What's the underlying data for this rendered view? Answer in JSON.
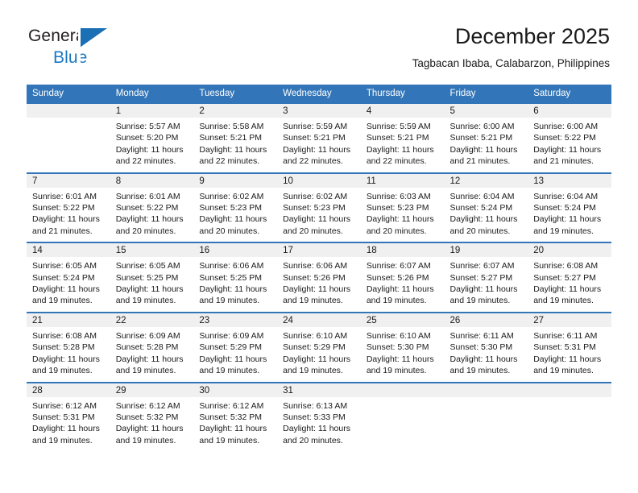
{
  "brand": {
    "line1": "General",
    "line2": "Blue",
    "accent_color": "#1b78c2",
    "triangle_color": "#1b6fb5"
  },
  "header": {
    "title": "December 2025",
    "subtitle": "Tagbacan Ibaba, Calabarzon, Philippines"
  },
  "calendar": {
    "header_bg": "#3275b8",
    "daynum_bg": "#f0f0f0",
    "weekdays": [
      "Sunday",
      "Monday",
      "Tuesday",
      "Wednesday",
      "Thursday",
      "Friday",
      "Saturday"
    ],
    "weeks": [
      [
        {
          "day": "",
          "lines": []
        },
        {
          "day": "1",
          "lines": [
            "Sunrise: 5:57 AM",
            "Sunset: 5:20 PM",
            "Daylight: 11 hours",
            "and 22 minutes."
          ]
        },
        {
          "day": "2",
          "lines": [
            "Sunrise: 5:58 AM",
            "Sunset: 5:21 PM",
            "Daylight: 11 hours",
            "and 22 minutes."
          ]
        },
        {
          "day": "3",
          "lines": [
            "Sunrise: 5:59 AM",
            "Sunset: 5:21 PM",
            "Daylight: 11 hours",
            "and 22 minutes."
          ]
        },
        {
          "day": "4",
          "lines": [
            "Sunrise: 5:59 AM",
            "Sunset: 5:21 PM",
            "Daylight: 11 hours",
            "and 22 minutes."
          ]
        },
        {
          "day": "5",
          "lines": [
            "Sunrise: 6:00 AM",
            "Sunset: 5:21 PM",
            "Daylight: 11 hours",
            "and 21 minutes."
          ]
        },
        {
          "day": "6",
          "lines": [
            "Sunrise: 6:00 AM",
            "Sunset: 5:22 PM",
            "Daylight: 11 hours",
            "and 21 minutes."
          ]
        }
      ],
      [
        {
          "day": "7",
          "lines": [
            "Sunrise: 6:01 AM",
            "Sunset: 5:22 PM",
            "Daylight: 11 hours",
            "and 21 minutes."
          ]
        },
        {
          "day": "8",
          "lines": [
            "Sunrise: 6:01 AM",
            "Sunset: 5:22 PM",
            "Daylight: 11 hours",
            "and 20 minutes."
          ]
        },
        {
          "day": "9",
          "lines": [
            "Sunrise: 6:02 AM",
            "Sunset: 5:23 PM",
            "Daylight: 11 hours",
            "and 20 minutes."
          ]
        },
        {
          "day": "10",
          "lines": [
            "Sunrise: 6:02 AM",
            "Sunset: 5:23 PM",
            "Daylight: 11 hours",
            "and 20 minutes."
          ]
        },
        {
          "day": "11",
          "lines": [
            "Sunrise: 6:03 AM",
            "Sunset: 5:23 PM",
            "Daylight: 11 hours",
            "and 20 minutes."
          ]
        },
        {
          "day": "12",
          "lines": [
            "Sunrise: 6:04 AM",
            "Sunset: 5:24 PM",
            "Daylight: 11 hours",
            "and 20 minutes."
          ]
        },
        {
          "day": "13",
          "lines": [
            "Sunrise: 6:04 AM",
            "Sunset: 5:24 PM",
            "Daylight: 11 hours",
            "and 19 minutes."
          ]
        }
      ],
      [
        {
          "day": "14",
          "lines": [
            "Sunrise: 6:05 AM",
            "Sunset: 5:24 PM",
            "Daylight: 11 hours",
            "and 19 minutes."
          ]
        },
        {
          "day": "15",
          "lines": [
            "Sunrise: 6:05 AM",
            "Sunset: 5:25 PM",
            "Daylight: 11 hours",
            "and 19 minutes."
          ]
        },
        {
          "day": "16",
          "lines": [
            "Sunrise: 6:06 AM",
            "Sunset: 5:25 PM",
            "Daylight: 11 hours",
            "and 19 minutes."
          ]
        },
        {
          "day": "17",
          "lines": [
            "Sunrise: 6:06 AM",
            "Sunset: 5:26 PM",
            "Daylight: 11 hours",
            "and 19 minutes."
          ]
        },
        {
          "day": "18",
          "lines": [
            "Sunrise: 6:07 AM",
            "Sunset: 5:26 PM",
            "Daylight: 11 hours",
            "and 19 minutes."
          ]
        },
        {
          "day": "19",
          "lines": [
            "Sunrise: 6:07 AM",
            "Sunset: 5:27 PM",
            "Daylight: 11 hours",
            "and 19 minutes."
          ]
        },
        {
          "day": "20",
          "lines": [
            "Sunrise: 6:08 AM",
            "Sunset: 5:27 PM",
            "Daylight: 11 hours",
            "and 19 minutes."
          ]
        }
      ],
      [
        {
          "day": "21",
          "lines": [
            "Sunrise: 6:08 AM",
            "Sunset: 5:28 PM",
            "Daylight: 11 hours",
            "and 19 minutes."
          ]
        },
        {
          "day": "22",
          "lines": [
            "Sunrise: 6:09 AM",
            "Sunset: 5:28 PM",
            "Daylight: 11 hours",
            "and 19 minutes."
          ]
        },
        {
          "day": "23",
          "lines": [
            "Sunrise: 6:09 AM",
            "Sunset: 5:29 PM",
            "Daylight: 11 hours",
            "and 19 minutes."
          ]
        },
        {
          "day": "24",
          "lines": [
            "Sunrise: 6:10 AM",
            "Sunset: 5:29 PM",
            "Daylight: 11 hours",
            "and 19 minutes."
          ]
        },
        {
          "day": "25",
          "lines": [
            "Sunrise: 6:10 AM",
            "Sunset: 5:30 PM",
            "Daylight: 11 hours",
            "and 19 minutes."
          ]
        },
        {
          "day": "26",
          "lines": [
            "Sunrise: 6:11 AM",
            "Sunset: 5:30 PM",
            "Daylight: 11 hours",
            "and 19 minutes."
          ]
        },
        {
          "day": "27",
          "lines": [
            "Sunrise: 6:11 AM",
            "Sunset: 5:31 PM",
            "Daylight: 11 hours",
            "and 19 minutes."
          ]
        }
      ],
      [
        {
          "day": "28",
          "lines": [
            "Sunrise: 6:12 AM",
            "Sunset: 5:31 PM",
            "Daylight: 11 hours",
            "and 19 minutes."
          ]
        },
        {
          "day": "29",
          "lines": [
            "Sunrise: 6:12 AM",
            "Sunset: 5:32 PM",
            "Daylight: 11 hours",
            "and 19 minutes."
          ]
        },
        {
          "day": "30",
          "lines": [
            "Sunrise: 6:12 AM",
            "Sunset: 5:32 PM",
            "Daylight: 11 hours",
            "and 19 minutes."
          ]
        },
        {
          "day": "31",
          "lines": [
            "Sunrise: 6:13 AM",
            "Sunset: 5:33 PM",
            "Daylight: 11 hours",
            "and 20 minutes."
          ]
        },
        {
          "day": "",
          "lines": []
        },
        {
          "day": "",
          "lines": []
        },
        {
          "day": "",
          "lines": []
        }
      ]
    ]
  }
}
